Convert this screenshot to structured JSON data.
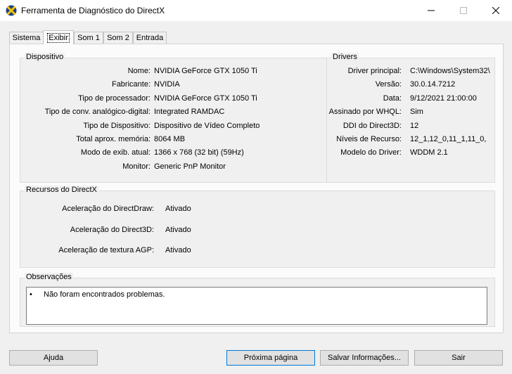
{
  "window": {
    "title": "Ferramenta de Diagnóstico do DirectX"
  },
  "tabs": [
    {
      "label": "Sistema"
    },
    {
      "label": "Exibir"
    },
    {
      "label": "Som 1"
    },
    {
      "label": "Som 2"
    },
    {
      "label": "Entrada"
    }
  ],
  "device": {
    "title": "Dispositivo",
    "rows": [
      {
        "label": "Nome:",
        "value": "NVIDIA GeForce GTX 1050 Ti"
      },
      {
        "label": "Fabricante:",
        "value": "NVIDIA"
      },
      {
        "label": "Tipo de processador:",
        "value": "NVIDIA GeForce GTX 1050 Ti"
      },
      {
        "label": "Tipo de conv. analógico-digital:",
        "value": "Integrated RAMDAC"
      },
      {
        "label": "Tipo de Dispositivo:",
        "value": "Dispositivo de Vídeo Completo"
      },
      {
        "label": "Total aprox. memória:",
        "value": "8064 MB"
      },
      {
        "label": "Modo de exib. atual:",
        "value": "1366 x 768 (32 bit) (59Hz)"
      },
      {
        "label": "Monitor:",
        "value": "Generic PnP Monitor"
      }
    ]
  },
  "drivers": {
    "title": "Drivers",
    "rows": [
      {
        "label": "Driver principal:",
        "value": "C:\\Windows\\System32\\"
      },
      {
        "label": "Versão:",
        "value": "30.0.14.7212"
      },
      {
        "label": "Data:",
        "value": "9/12/2021 21:00:00"
      },
      {
        "label": "Assinado por WHQL:",
        "value": "Sim"
      },
      {
        "label": "DDI do Direct3D:",
        "value": "12"
      },
      {
        "label": "Níveis de Recurso:",
        "value": "12_1,12_0,11_1,11_0,"
      },
      {
        "label": "Modelo do Driver:",
        "value": "WDDM 2.1"
      }
    ]
  },
  "directx": {
    "title": "Recursos do DirectX",
    "rows": [
      {
        "label": "Aceleração do DirectDraw:",
        "value": "Ativado"
      },
      {
        "label": "Aceleração do Direct3D:",
        "value": "Ativado"
      },
      {
        "label": "Aceleração de textura AGP:",
        "value": "Ativado"
      }
    ]
  },
  "notes": {
    "title": "Observações",
    "items": [
      "Não foram encontrados problemas."
    ]
  },
  "buttons": {
    "help": "Ajuda",
    "next": "Próxima página",
    "save": "Salvar Informações...",
    "exit": "Sair"
  }
}
